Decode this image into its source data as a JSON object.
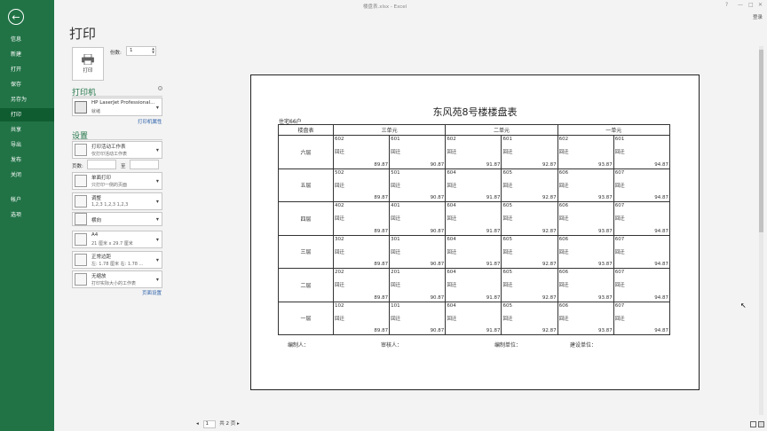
{
  "window": {
    "title": "楼盘表.xlsx - Excel",
    "login": "登录",
    "controls": [
      "?",
      "—",
      "□",
      "✕"
    ]
  },
  "nav": {
    "items": [
      {
        "label": "信息",
        "active": false
      },
      {
        "label": "新建",
        "active": false
      },
      {
        "label": "打开",
        "active": false
      },
      {
        "label": "保存",
        "active": false
      },
      {
        "label": "另存为",
        "active": false
      },
      {
        "label": "打印",
        "active": true
      },
      {
        "label": "共享",
        "active": false
      },
      {
        "label": "导出",
        "active": false
      },
      {
        "label": "发布",
        "active": false
      },
      {
        "label": "关闭",
        "active": false
      },
      {
        "label": "帐户",
        "active": false
      },
      {
        "label": "选项",
        "active": false
      }
    ]
  },
  "print": {
    "title": "打印",
    "button_label": "打印",
    "copies_label": "份数:",
    "copies_value": "1",
    "printer_section": "打印机",
    "printer_name": "HP LaserJet Professional...",
    "printer_status": "就绪",
    "printer_props": "打印机属性",
    "settings_section": "设置",
    "settings": [
      {
        "l1": "打印活动工作表",
        "l2": "仅打印活动工作表"
      },
      {
        "l1": "单面打印",
        "l2": "只打印一侧的页面"
      },
      {
        "l1": "调整",
        "l2": "1,2,3    1,2,3    1,2,3"
      },
      {
        "l1": "横向",
        "l2": ""
      },
      {
        "l1": "A4",
        "l2": "21 厘米 x 29.7 厘米"
      },
      {
        "l1": "正常边距",
        "l2": "左: 1.78 厘米    右: 1.78 ..."
      },
      {
        "l1": "无缩放",
        "l2": "打印实际大小的工作表"
      }
    ],
    "pages_label": "页数:",
    "to_label": "至",
    "page_setup": "页面设置",
    "pager_current": "1",
    "pager_total": "共 2 页"
  },
  "sheet": {
    "title": "东风苑8号楼楼盘表",
    "subtitle": "住宅66户",
    "corner": "楼盘表",
    "units": [
      "三单元",
      "二单元",
      "一单元"
    ],
    "rows": [
      {
        "floor": "六层",
        "cells": [
          {
            "room": "602",
            "status": "回迁",
            "price": "89.87"
          },
          {
            "room": "601",
            "status": "回迁",
            "price": "90.87"
          },
          {
            "room": "602",
            "status": "回迁",
            "price": "91.87"
          },
          {
            "room": "601",
            "status": "回迁",
            "price": "92.87"
          },
          {
            "room": "602",
            "status": "回迁",
            "price": "93.87"
          },
          {
            "room": "601",
            "status": "回迁",
            "price": "94.87"
          }
        ]
      },
      {
        "floor": "五层",
        "cells": [
          {
            "room": "502",
            "status": "回迁",
            "price": "89.87"
          },
          {
            "room": "501",
            "status": "回迁",
            "price": "90.87"
          },
          {
            "room": "604",
            "status": "回迁",
            "price": "91.87"
          },
          {
            "room": "605",
            "status": "回迁",
            "price": "92.87"
          },
          {
            "room": "606",
            "status": "回迁",
            "price": "93.87"
          },
          {
            "room": "607",
            "status": "回迁",
            "price": "94.87"
          }
        ]
      },
      {
        "floor": "四层",
        "cells": [
          {
            "room": "402",
            "status": "回迁",
            "price": "89.87"
          },
          {
            "room": "401",
            "status": "回迁",
            "price": "90.87"
          },
          {
            "room": "604",
            "status": "回迁",
            "price": "91.87"
          },
          {
            "room": "605",
            "status": "回迁",
            "price": "92.87"
          },
          {
            "room": "606",
            "status": "回迁",
            "price": "93.87"
          },
          {
            "room": "607",
            "status": "回迁",
            "price": "94.87"
          }
        ]
      },
      {
        "floor": "三层",
        "cells": [
          {
            "room": "302",
            "status": "回迁",
            "price": "89.87"
          },
          {
            "room": "301",
            "status": "回迁",
            "price": "90.87"
          },
          {
            "room": "604",
            "status": "回迁",
            "price": "91.87"
          },
          {
            "room": "605",
            "status": "回迁",
            "price": "92.87"
          },
          {
            "room": "606",
            "status": "回迁",
            "price": "93.87"
          },
          {
            "room": "607",
            "status": "回迁",
            "price": "94.87"
          }
        ]
      },
      {
        "floor": "二层",
        "cells": [
          {
            "room": "202",
            "status": "回迁",
            "price": "89.87"
          },
          {
            "room": "201",
            "status": "回迁",
            "price": "90.87"
          },
          {
            "room": "604",
            "status": "回迁",
            "price": "91.87"
          },
          {
            "room": "605",
            "status": "回迁",
            "price": "92.87"
          },
          {
            "room": "606",
            "status": "回迁",
            "price": "93.87"
          },
          {
            "room": "607",
            "status": "回迁",
            "price": "94.87"
          }
        ]
      },
      {
        "floor": "一层",
        "cells": [
          {
            "room": "102",
            "status": "回迁",
            "price": "89.87"
          },
          {
            "room": "101",
            "status": "回迁",
            "price": "90.87"
          },
          {
            "room": "604",
            "status": "回迁",
            "price": "91.87"
          },
          {
            "room": "605",
            "status": "回迁",
            "price": "92.87"
          },
          {
            "room": "606",
            "status": "回迁",
            "price": "93.87"
          },
          {
            "room": "607",
            "status": "回迁",
            "price": "94.87"
          }
        ]
      }
    ],
    "footer": [
      "编制人：",
      "审核人：",
      "编制单位：",
      "建设单位："
    ]
  },
  "colors": {
    "accent": "#217346"
  },
  "icons": [
    "back-arrow-icon",
    "printer-icon",
    "info-icon",
    "dropdown-arrow-icon"
  ]
}
